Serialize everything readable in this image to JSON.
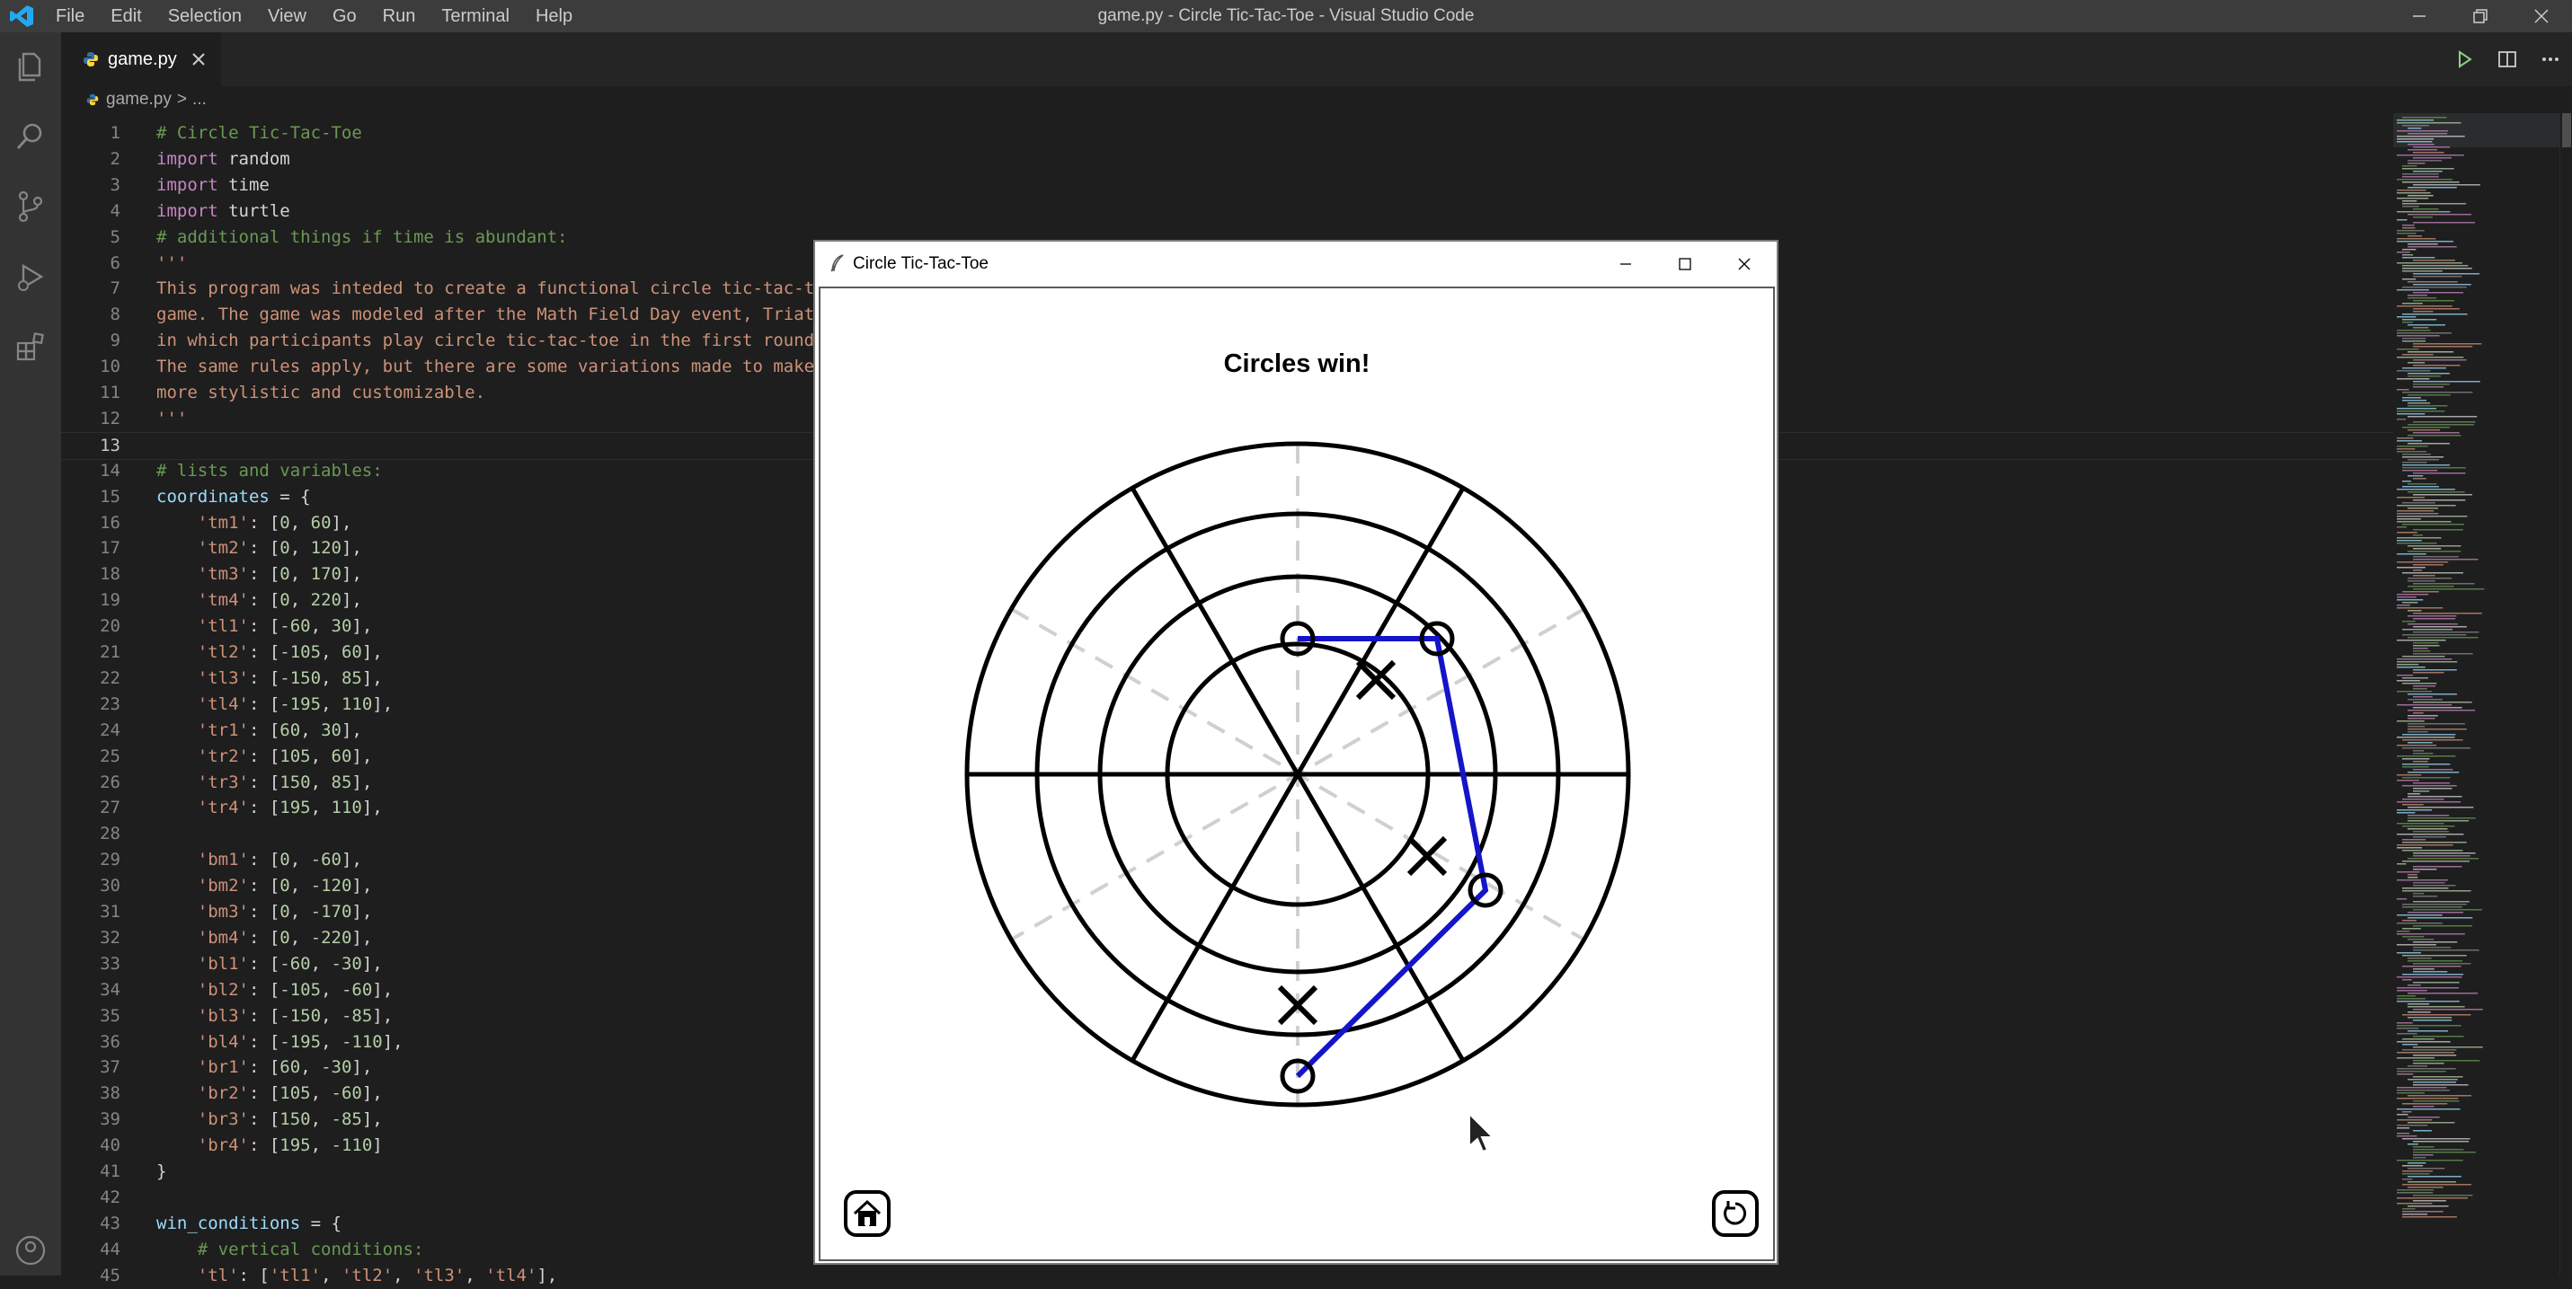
{
  "window": {
    "title": "game.py - Circle Tic-Tac-Toe - Visual Studio Code"
  },
  "menu": [
    "File",
    "Edit",
    "Selection",
    "View",
    "Go",
    "Run",
    "Terminal",
    "Help"
  ],
  "activity_bar": [
    "explorer-icon",
    "search-icon",
    "source-control-icon",
    "run-debug-icon",
    "extensions-icon",
    "accounts-icon"
  ],
  "tab": {
    "filename": "game.py"
  },
  "breadcrumb": {
    "file": "game.py",
    "sep": ">",
    "tail": "..."
  },
  "editor": {
    "current_line": 13,
    "lines": [
      {
        "n": "1",
        "t": [
          [
            "c",
            "# Circle Tic-Tac-Toe"
          ]
        ]
      },
      {
        "n": "2",
        "t": [
          [
            "k",
            "import"
          ],
          [
            "p",
            " random"
          ]
        ]
      },
      {
        "n": "3",
        "t": [
          [
            "k",
            "import"
          ],
          [
            "p",
            " time"
          ]
        ]
      },
      {
        "n": "4",
        "t": [
          [
            "k",
            "import"
          ],
          [
            "p",
            " turtle"
          ]
        ]
      },
      {
        "n": "5",
        "t": [
          [
            "c",
            "# additional things if time is abundant:"
          ]
        ]
      },
      {
        "n": "6",
        "t": [
          [
            "s",
            "'''"
          ]
        ]
      },
      {
        "n": "7",
        "t": [
          [
            "s",
            "This program was inteded to create a functional circle tic-tac-t"
          ]
        ]
      },
      {
        "n": "8",
        "t": [
          [
            "s",
            "game. The game was modeled after the Math Field Day event, Triat"
          ]
        ]
      },
      {
        "n": "9",
        "t": [
          [
            "s",
            "in which participants play circle tic-tac-toe in the first round"
          ]
        ]
      },
      {
        "n": "10",
        "t": [
          [
            "s",
            "The same rules apply, but there are some variations made to make"
          ]
        ]
      },
      {
        "n": "11",
        "t": [
          [
            "s",
            "more stylistic and customizable."
          ]
        ]
      },
      {
        "n": "12",
        "t": [
          [
            "s",
            "'''"
          ]
        ]
      },
      {
        "n": "13",
        "t": []
      },
      {
        "n": "14",
        "t": [
          [
            "c",
            "# lists and variables:"
          ]
        ]
      },
      {
        "n": "15",
        "t": [
          [
            "v",
            "coordinates"
          ],
          [
            "p",
            " = {"
          ]
        ]
      },
      {
        "n": "16",
        "t": [
          [
            "p",
            "    "
          ],
          [
            "s",
            "'tm1'"
          ],
          [
            "p",
            ": ["
          ],
          [
            "n",
            "0"
          ],
          [
            "p",
            ", "
          ],
          [
            "n",
            "60"
          ],
          [
            "p",
            "],"
          ]
        ]
      },
      {
        "n": "17",
        "t": [
          [
            "p",
            "    "
          ],
          [
            "s",
            "'tm2'"
          ],
          [
            "p",
            ": ["
          ],
          [
            "n",
            "0"
          ],
          [
            "p",
            ", "
          ],
          [
            "n",
            "120"
          ],
          [
            "p",
            "],"
          ]
        ]
      },
      {
        "n": "18",
        "t": [
          [
            "p",
            "    "
          ],
          [
            "s",
            "'tm3'"
          ],
          [
            "p",
            ": ["
          ],
          [
            "n",
            "0"
          ],
          [
            "p",
            ", "
          ],
          [
            "n",
            "170"
          ],
          [
            "p",
            "],"
          ]
        ]
      },
      {
        "n": "19",
        "t": [
          [
            "p",
            "    "
          ],
          [
            "s",
            "'tm4'"
          ],
          [
            "p",
            ": ["
          ],
          [
            "n",
            "0"
          ],
          [
            "p",
            ", "
          ],
          [
            "n",
            "220"
          ],
          [
            "p",
            "],"
          ]
        ]
      },
      {
        "n": "20",
        "t": [
          [
            "p",
            "    "
          ],
          [
            "s",
            "'tl1'"
          ],
          [
            "p",
            ": ["
          ],
          [
            "n",
            "-60"
          ],
          [
            "p",
            ", "
          ],
          [
            "n",
            "30"
          ],
          [
            "p",
            "],"
          ]
        ]
      },
      {
        "n": "21",
        "t": [
          [
            "p",
            "    "
          ],
          [
            "s",
            "'tl2'"
          ],
          [
            "p",
            ": ["
          ],
          [
            "n",
            "-105"
          ],
          [
            "p",
            ", "
          ],
          [
            "n",
            "60"
          ],
          [
            "p",
            "],"
          ]
        ]
      },
      {
        "n": "22",
        "t": [
          [
            "p",
            "    "
          ],
          [
            "s",
            "'tl3'"
          ],
          [
            "p",
            ": ["
          ],
          [
            "n",
            "-150"
          ],
          [
            "p",
            ", "
          ],
          [
            "n",
            "85"
          ],
          [
            "p",
            "],"
          ]
        ]
      },
      {
        "n": "23",
        "t": [
          [
            "p",
            "    "
          ],
          [
            "s",
            "'tl4'"
          ],
          [
            "p",
            ": ["
          ],
          [
            "n",
            "-195"
          ],
          [
            "p",
            ", "
          ],
          [
            "n",
            "110"
          ],
          [
            "p",
            "],"
          ]
        ]
      },
      {
        "n": "24",
        "t": [
          [
            "p",
            "    "
          ],
          [
            "s",
            "'tr1'"
          ],
          [
            "p",
            ": ["
          ],
          [
            "n",
            "60"
          ],
          [
            "p",
            ", "
          ],
          [
            "n",
            "30"
          ],
          [
            "p",
            "],"
          ]
        ]
      },
      {
        "n": "25",
        "t": [
          [
            "p",
            "    "
          ],
          [
            "s",
            "'tr2'"
          ],
          [
            "p",
            ": ["
          ],
          [
            "n",
            "105"
          ],
          [
            "p",
            ", "
          ],
          [
            "n",
            "60"
          ],
          [
            "p",
            "],"
          ]
        ]
      },
      {
        "n": "26",
        "t": [
          [
            "p",
            "    "
          ],
          [
            "s",
            "'tr3'"
          ],
          [
            "p",
            ": ["
          ],
          [
            "n",
            "150"
          ],
          [
            "p",
            ", "
          ],
          [
            "n",
            "85"
          ],
          [
            "p",
            "],"
          ]
        ]
      },
      {
        "n": "27",
        "t": [
          [
            "p",
            "    "
          ],
          [
            "s",
            "'tr4'"
          ],
          [
            "p",
            ": ["
          ],
          [
            "n",
            "195"
          ],
          [
            "p",
            ", "
          ],
          [
            "n",
            "110"
          ],
          [
            "p",
            "],"
          ]
        ]
      },
      {
        "n": "28",
        "t": []
      },
      {
        "n": "29",
        "t": [
          [
            "p",
            "    "
          ],
          [
            "s",
            "'bm1'"
          ],
          [
            "p",
            ": ["
          ],
          [
            "n",
            "0"
          ],
          [
            "p",
            ", "
          ],
          [
            "n",
            "-60"
          ],
          [
            "p",
            "],"
          ]
        ]
      },
      {
        "n": "30",
        "t": [
          [
            "p",
            "    "
          ],
          [
            "s",
            "'bm2'"
          ],
          [
            "p",
            ": ["
          ],
          [
            "n",
            "0"
          ],
          [
            "p",
            ", "
          ],
          [
            "n",
            "-120"
          ],
          [
            "p",
            "],"
          ]
        ]
      },
      {
        "n": "31",
        "t": [
          [
            "p",
            "    "
          ],
          [
            "s",
            "'bm3'"
          ],
          [
            "p",
            ": ["
          ],
          [
            "n",
            "0"
          ],
          [
            "p",
            ", "
          ],
          [
            "n",
            "-170"
          ],
          [
            "p",
            "],"
          ]
        ]
      },
      {
        "n": "32",
        "t": [
          [
            "p",
            "    "
          ],
          [
            "s",
            "'bm4'"
          ],
          [
            "p",
            ": ["
          ],
          [
            "n",
            "0"
          ],
          [
            "p",
            ", "
          ],
          [
            "n",
            "-220"
          ],
          [
            "p",
            "],"
          ]
        ]
      },
      {
        "n": "33",
        "t": [
          [
            "p",
            "    "
          ],
          [
            "s",
            "'bl1'"
          ],
          [
            "p",
            ": ["
          ],
          [
            "n",
            "-60"
          ],
          [
            "p",
            ", "
          ],
          [
            "n",
            "-30"
          ],
          [
            "p",
            "],"
          ]
        ]
      },
      {
        "n": "34",
        "t": [
          [
            "p",
            "    "
          ],
          [
            "s",
            "'bl2'"
          ],
          [
            "p",
            ": ["
          ],
          [
            "n",
            "-105"
          ],
          [
            "p",
            ", "
          ],
          [
            "n",
            "-60"
          ],
          [
            "p",
            "],"
          ]
        ]
      },
      {
        "n": "35",
        "t": [
          [
            "p",
            "    "
          ],
          [
            "s",
            "'bl3'"
          ],
          [
            "p",
            ": ["
          ],
          [
            "n",
            "-150"
          ],
          [
            "p",
            ", "
          ],
          [
            "n",
            "-85"
          ],
          [
            "p",
            "],"
          ]
        ]
      },
      {
        "n": "36",
        "t": [
          [
            "p",
            "    "
          ],
          [
            "s",
            "'bl4'"
          ],
          [
            "p",
            ": ["
          ],
          [
            "n",
            "-195"
          ],
          [
            "p",
            ", "
          ],
          [
            "n",
            "-110"
          ],
          [
            "p",
            "],"
          ]
        ]
      },
      {
        "n": "37",
        "t": [
          [
            "p",
            "    "
          ],
          [
            "s",
            "'br1'"
          ],
          [
            "p",
            ": ["
          ],
          [
            "n",
            "60"
          ],
          [
            "p",
            ", "
          ],
          [
            "n",
            "-30"
          ],
          [
            "p",
            "],"
          ]
        ]
      },
      {
        "n": "38",
        "t": [
          [
            "p",
            "    "
          ],
          [
            "s",
            "'br2'"
          ],
          [
            "p",
            ": ["
          ],
          [
            "n",
            "105"
          ],
          [
            "p",
            ", "
          ],
          [
            "n",
            "-60"
          ],
          [
            "p",
            "],"
          ]
        ]
      },
      {
        "n": "39",
        "t": [
          [
            "p",
            "    "
          ],
          [
            "s",
            "'br3'"
          ],
          [
            "p",
            ": ["
          ],
          [
            "n",
            "150"
          ],
          [
            "p",
            ", "
          ],
          [
            "n",
            "-85"
          ],
          [
            "p",
            "],"
          ]
        ]
      },
      {
        "n": "40",
        "t": [
          [
            "p",
            "    "
          ],
          [
            "s",
            "'br4'"
          ],
          [
            "p",
            ": ["
          ],
          [
            "n",
            "195"
          ],
          [
            "p",
            ", "
          ],
          [
            "n",
            "-110"
          ],
          [
            "p",
            "]"
          ]
        ]
      },
      {
        "n": "41",
        "t": [
          [
            "p",
            "}"
          ]
        ]
      },
      {
        "n": "42",
        "t": []
      },
      {
        "n": "43",
        "t": [
          [
            "v",
            "win_conditions"
          ],
          [
            "p",
            " = {"
          ]
        ]
      },
      {
        "n": "44",
        "t": [
          [
            "p",
            "    "
          ],
          [
            "c",
            "# vertical conditions:"
          ]
        ]
      },
      {
        "n": "45",
        "t": [
          [
            "p",
            "    "
          ],
          [
            "s",
            "'tl'"
          ],
          [
            "p",
            ": ["
          ],
          [
            "s",
            "'tl1'"
          ],
          [
            "p",
            ", "
          ],
          [
            "s",
            "'tl2'"
          ],
          [
            "p",
            ", "
          ],
          [
            "s",
            "'tl3'"
          ],
          [
            "p",
            ", "
          ],
          [
            "s",
            "'tl4'"
          ],
          [
            "p",
            "],"
          ]
        ]
      }
    ]
  },
  "turtle_window": {
    "title": "Circle Tic-Tac-Toe",
    "status": "Circles win!",
    "home_button_icon": "home-icon",
    "restart_button_icon": "restart-icon",
    "board": {
      "rings": 4,
      "sectors": 6,
      "circles": [
        "tm1",
        "tr1",
        "br3",
        "bm4"
      ],
      "crosses": [
        "tr1_inner",
        "br2",
        "bm3"
      ],
      "win_path": [
        "tm1",
        "tr1",
        "br3",
        "bm4"
      ],
      "colors": {
        "lines": "#000000",
        "guides": "#d0d0d0",
        "win_line": "#1414c8"
      }
    }
  },
  "colors": {
    "accent": "#007acc",
    "editor_bg": "#1e1e1e",
    "titlebar": "#3c3c3c",
    "activity": "#333333"
  }
}
